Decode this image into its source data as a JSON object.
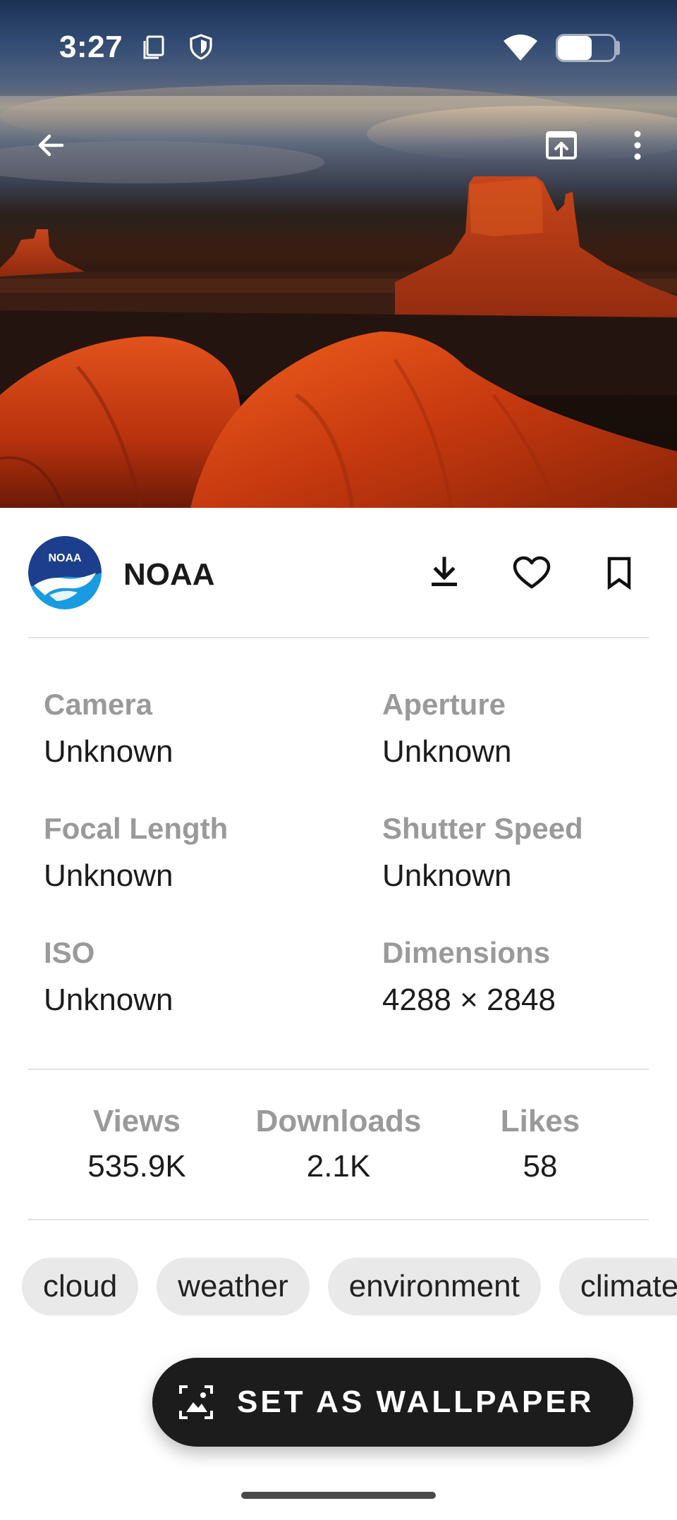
{
  "status_bar": {
    "time": "3:27",
    "battery_level": 0.6,
    "icons": [
      "screenshot-icon",
      "shield-icon",
      "wifi-icon",
      "battery-icon"
    ]
  },
  "toolbar": {
    "back_icon": "arrow-left-icon",
    "open_icon": "open-in-browser-icon",
    "more_icon": "more-vert-icon"
  },
  "author": {
    "name": "NOAA",
    "avatar_text": "NOAA"
  },
  "actions": [
    "download-icon",
    "heart-icon",
    "bookmark-icon"
  ],
  "exif": [
    {
      "label": "Camera",
      "value": "Unknown"
    },
    {
      "label": "Aperture",
      "value": "Unknown"
    },
    {
      "label": "Focal Length",
      "value": "Unknown"
    },
    {
      "label": "Shutter Speed",
      "value": "Unknown"
    },
    {
      "label": "ISO",
      "value": "Unknown"
    },
    {
      "label": "Dimensions",
      "value": "4288 × 2848"
    }
  ],
  "stats": [
    {
      "label": "Views",
      "value": "535.9K"
    },
    {
      "label": "Downloads",
      "value": "2.1K"
    },
    {
      "label": "Likes",
      "value": "58"
    }
  ],
  "tags": [
    "cloud",
    "weather",
    "environment",
    "climate"
  ],
  "fab": {
    "label": "SET AS WALLPAPER",
    "icon": "wallpaper-icon"
  },
  "colors": {
    "accent_dark": "#1c1c1c",
    "chip_bg": "#e9e9e9",
    "label_gray": "#9a9a9a",
    "noaa_blue": "#1a9ae0",
    "noaa_navy": "#1c3e8c"
  }
}
